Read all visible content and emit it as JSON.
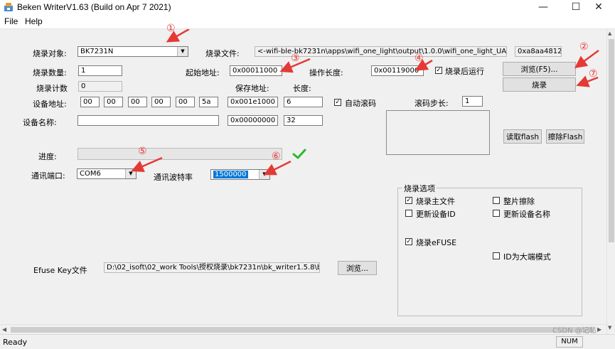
{
  "window": {
    "title": "Beken WriterV1.63 (Build on Apr  7 2021)",
    "minimize": "—",
    "maximize": "☐",
    "close": "✕"
  },
  "menu": {
    "file": "File",
    "help": "Help"
  },
  "form": {
    "target_label": "烧录对象:",
    "target_value": "BK7231N",
    "file_label": "烧录文件:",
    "file_path": "<-wifi-ble-bk7231n\\apps\\wifi_one_light\\output\\1.0.0\\wifi_one_light_UA_1.0.0.bin",
    "file_crc": "0xa8aa4812",
    "count_label": "烧录数量:",
    "count_value": "1",
    "start_addr_label": "起始地址:",
    "start_addr_value": "0x00011000",
    "op_len_label": "操作长度:",
    "op_len_value": "0x00119000",
    "run_after_label": "烧录后运行",
    "counter_label": "烧录计数",
    "counter_value": "0",
    "save_addr_label": "保存地址:",
    "length_label": "长度:",
    "dev_addr_label": "设备地址:",
    "dev_addr_bytes": [
      "00",
      "00",
      "00",
      "00",
      "00",
      "5a"
    ],
    "dev_addr_save": "0x001e1000",
    "dev_addr_len": "6",
    "auto_roll_label": "自动滚码",
    "roll_step_label": "滚码步长:",
    "roll_step_value": "1",
    "dev_name_label": "设备名称:",
    "dev_name_value": "",
    "dev_name_save": "0x00000000",
    "dev_name_len": "32",
    "progress_label": "进度:",
    "progress_fraction": 0,
    "port_label": "通讯端口:",
    "port_value": "COM6",
    "baud_label": "通讯波特率",
    "baud_value": "1500000",
    "efuse_label": "Efuse Key文件",
    "efuse_path": "D:\\02_isoft\\02_work Tools\\授权烧录\\bk7231n\\bk_writer1.5.8\\bk_writ",
    "efuse_browse": "浏览..."
  },
  "buttons": {
    "browse": "浏览(F5)...",
    "burn": "烧录",
    "read_flash": "读取flash",
    "erase_flash": "擦除Flash"
  },
  "options": {
    "title": "烧录选项",
    "items": [
      {
        "label": "烧录主文件",
        "checked": true
      },
      {
        "label": "整片擦除",
        "checked": false
      },
      {
        "label": "更新设备ID",
        "checked": false
      },
      {
        "label": "更新设备名称",
        "checked": false
      },
      {
        "label": "烧录eFUSE",
        "checked": true
      },
      {
        "label": "ID为大端模式",
        "checked": false
      }
    ]
  },
  "annotations": [
    "①",
    "②",
    "③",
    "④",
    "⑤",
    "⑥",
    "⑦"
  ],
  "status": {
    "ready": "Ready",
    "num": "NUM",
    "watermark": "CSDN @记帖"
  },
  "colors": {
    "arrow": "#e53935",
    "check_ok": "#2db82d",
    "selection": "#0078d7"
  }
}
